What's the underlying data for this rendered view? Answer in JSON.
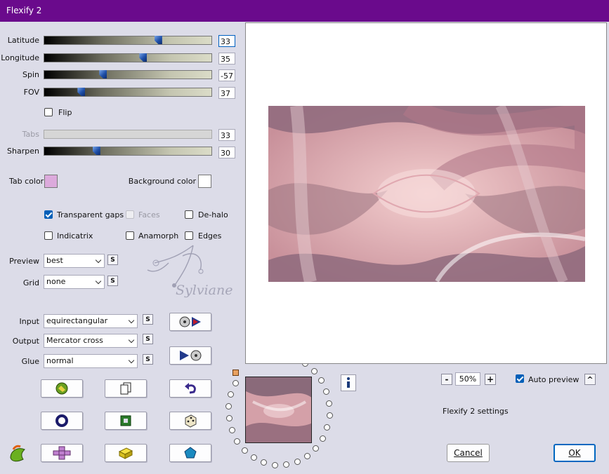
{
  "window": {
    "title": "Flexify 2"
  },
  "sliders": [
    {
      "label": "Latitude",
      "value": "33",
      "level": 0.68,
      "focused": true,
      "disabled": false
    },
    {
      "label": "Longitude",
      "value": "35",
      "level": 0.59,
      "focused": false,
      "disabled": false
    },
    {
      "label": "Spin",
      "value": "-57",
      "level": 0.35,
      "focused": false,
      "disabled": false
    },
    {
      "label": "FOV",
      "value": "37",
      "level": 0.22,
      "focused": false,
      "disabled": false
    },
    {
      "label": "Tabs",
      "value": "33",
      "level": null,
      "focused": false,
      "disabled": true
    },
    {
      "label": "Sharpen",
      "value": "30",
      "level": 0.31,
      "focused": false,
      "disabled": false
    }
  ],
  "flip": {
    "label": "Flip",
    "checked": false
  },
  "colors": {
    "tab_color_label": "Tab color",
    "tab_color": "#dcaadc",
    "background_color_label": "Background color",
    "background_color": "#ffffff",
    "title_bar": "#6a0a8c",
    "accent": "#005fb8"
  },
  "options": [
    {
      "label": "Transparent gaps",
      "checked": true,
      "disabled": false
    },
    {
      "label": "Faces",
      "checked": false,
      "disabled": true
    },
    {
      "label": "De-halo",
      "checked": false,
      "disabled": false
    },
    {
      "label": "Indicatrix",
      "checked": false,
      "disabled": false
    },
    {
      "label": "Anamorph",
      "checked": false,
      "disabled": false
    },
    {
      "label": "Edges",
      "checked": false,
      "disabled": false
    }
  ],
  "combos": {
    "preview": {
      "label": "Preview",
      "value": "best"
    },
    "grid": {
      "label": "Grid",
      "value": "none"
    },
    "input": {
      "label": "Input",
      "value": "equirectangular"
    },
    "output": {
      "label": "Output",
      "value": "Mercator cross"
    },
    "glue": {
      "label": "Glue",
      "value": "normal"
    }
  },
  "small_button_label": "S",
  "watermark": "Sylviane",
  "zoom": {
    "value": "50%",
    "minus": "-",
    "plus": "+"
  },
  "auto_preview": {
    "label": "Auto preview",
    "checked": true
  },
  "collapse_label": "^",
  "settings_label": "Flexify 2 settings",
  "buttons": {
    "cancel": "Cancel",
    "ok": "OK"
  },
  "icons": [
    "load-preset-icon",
    "copy-icon",
    "undo-icon",
    "ring-icon",
    "frame-icon",
    "dice-icon",
    "plus-shape-icon",
    "brick-icon",
    "pentagon-icon",
    "input-convert-icon",
    "output-convert-icon",
    "info-icon",
    "app-logo-icon"
  ]
}
